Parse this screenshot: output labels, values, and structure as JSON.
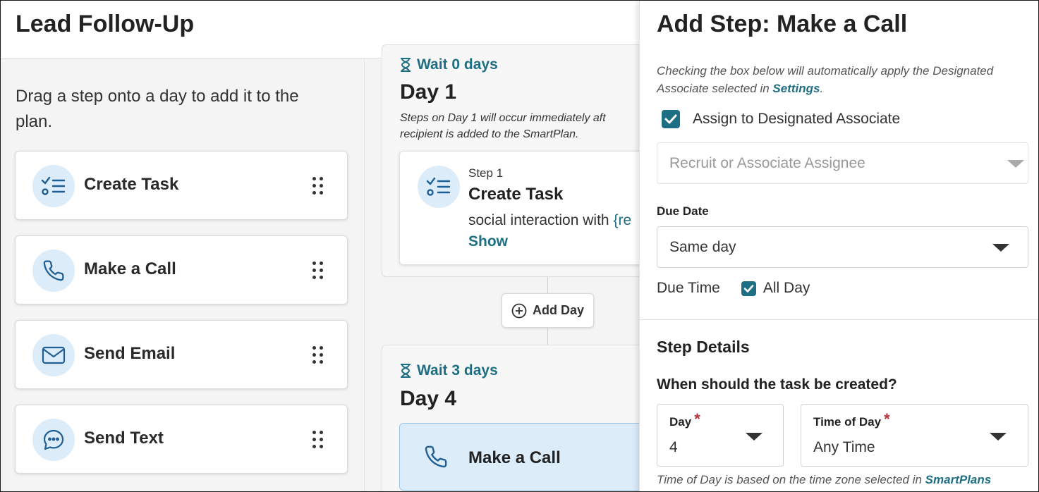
{
  "header": {
    "title": "Lead Follow-Up"
  },
  "palette": {
    "hint": "Drag a step onto a day to add it to the plan.",
    "items": [
      {
        "label": "Create Task",
        "icon": "checklist-icon"
      },
      {
        "label": "Make a Call",
        "icon": "phone-icon"
      },
      {
        "label": "Send Email",
        "icon": "envelope-icon"
      },
      {
        "label": "Send Text",
        "icon": "chat-bubble-icon"
      }
    ]
  },
  "timeline": {
    "days": [
      {
        "wait": "Wait 0 days",
        "title": "Day 1",
        "note_line1": "Steps on Day 1 will occur immediately aft",
        "note_line2": "recipient is added to the SmartPlan.",
        "steps": [
          {
            "number": "Step 1",
            "title": "Create Task",
            "desc_prefix": "social interaction with ",
            "desc_token": "{re",
            "show": "Show"
          }
        ]
      },
      {
        "wait": "Wait 3 days",
        "title": "Day 4",
        "steps": [
          {
            "title": "Make a Call"
          }
        ]
      }
    ],
    "add_day": "Add Day"
  },
  "panel": {
    "title": "Add Step: Make a Call",
    "help_text": "Checking the box below will automatically apply the Designated Associate selected in ",
    "help_link": "Settings",
    "help_end": ".",
    "assign_label": "Assign to Designated Associate",
    "assign_checked": true,
    "assignee_placeholder": "Recruit or Associate Assignee",
    "due_date_label": "Due Date",
    "due_date_value": "Same day",
    "due_time_label": "Due Time",
    "all_day_label": "All Day",
    "all_day_checked": true,
    "section_title": "Step Details",
    "question": "When should the task be created?",
    "day_label": "Day",
    "day_value": "4",
    "time_label": "Time of Day",
    "time_value": "Any Time",
    "required_mark": "*",
    "footnote_text": "Time of Day is based on the time zone selected in ",
    "footnote_link": "SmartPlans"
  },
  "colors": {
    "accent": "#1e6f83",
    "icon_bg": "#dcecf9",
    "icon_stroke": "#1f5f93",
    "required": "#b5333a"
  }
}
